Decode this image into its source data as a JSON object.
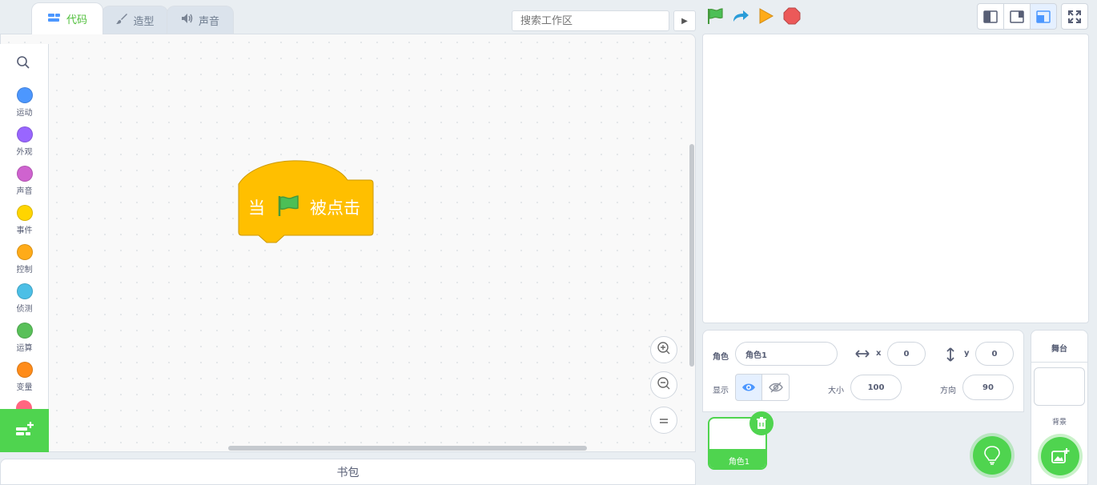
{
  "tabs": [
    {
      "label": "代码",
      "icon": "code-icon"
    },
    {
      "label": "造型",
      "icon": "brush-icon"
    },
    {
      "label": "声音",
      "icon": "speaker-icon"
    }
  ],
  "search": {
    "placeholder": "搜索工作区"
  },
  "categories": [
    {
      "label": "运动",
      "color": "#4c97ff"
    },
    {
      "label": "外观",
      "color": "#9966ff"
    },
    {
      "label": "声音",
      "color": "#cf63cf"
    },
    {
      "label": "事件",
      "color": "#ffd500"
    },
    {
      "label": "控制",
      "color": "#ffab19"
    },
    {
      "label": "侦测",
      "color": "#4cbfe6"
    },
    {
      "label": "运算",
      "color": "#59c059"
    },
    {
      "label": "变量",
      "color": "#ff8c1a"
    }
  ],
  "block": {
    "prefix": "当",
    "suffix": "被点击",
    "color": "#ffbf00"
  },
  "backpack": {
    "label": "书包"
  },
  "sprite": {
    "label": "角色",
    "name": "角色1",
    "x_label": "x",
    "x": "0",
    "y_label": "y",
    "y": "0",
    "show_label": "显示",
    "size_label": "大小",
    "size": "100",
    "direction_label": "方向",
    "direction": "90"
  },
  "sprite_thumb": {
    "name": "角色1"
  },
  "stage_panel": {
    "title": "舞台",
    "backdrop_label": "背景"
  },
  "colors": {
    "accent": "#4fbf3a",
    "green_button": "#4fd44f",
    "blue": "#4c97ff"
  }
}
